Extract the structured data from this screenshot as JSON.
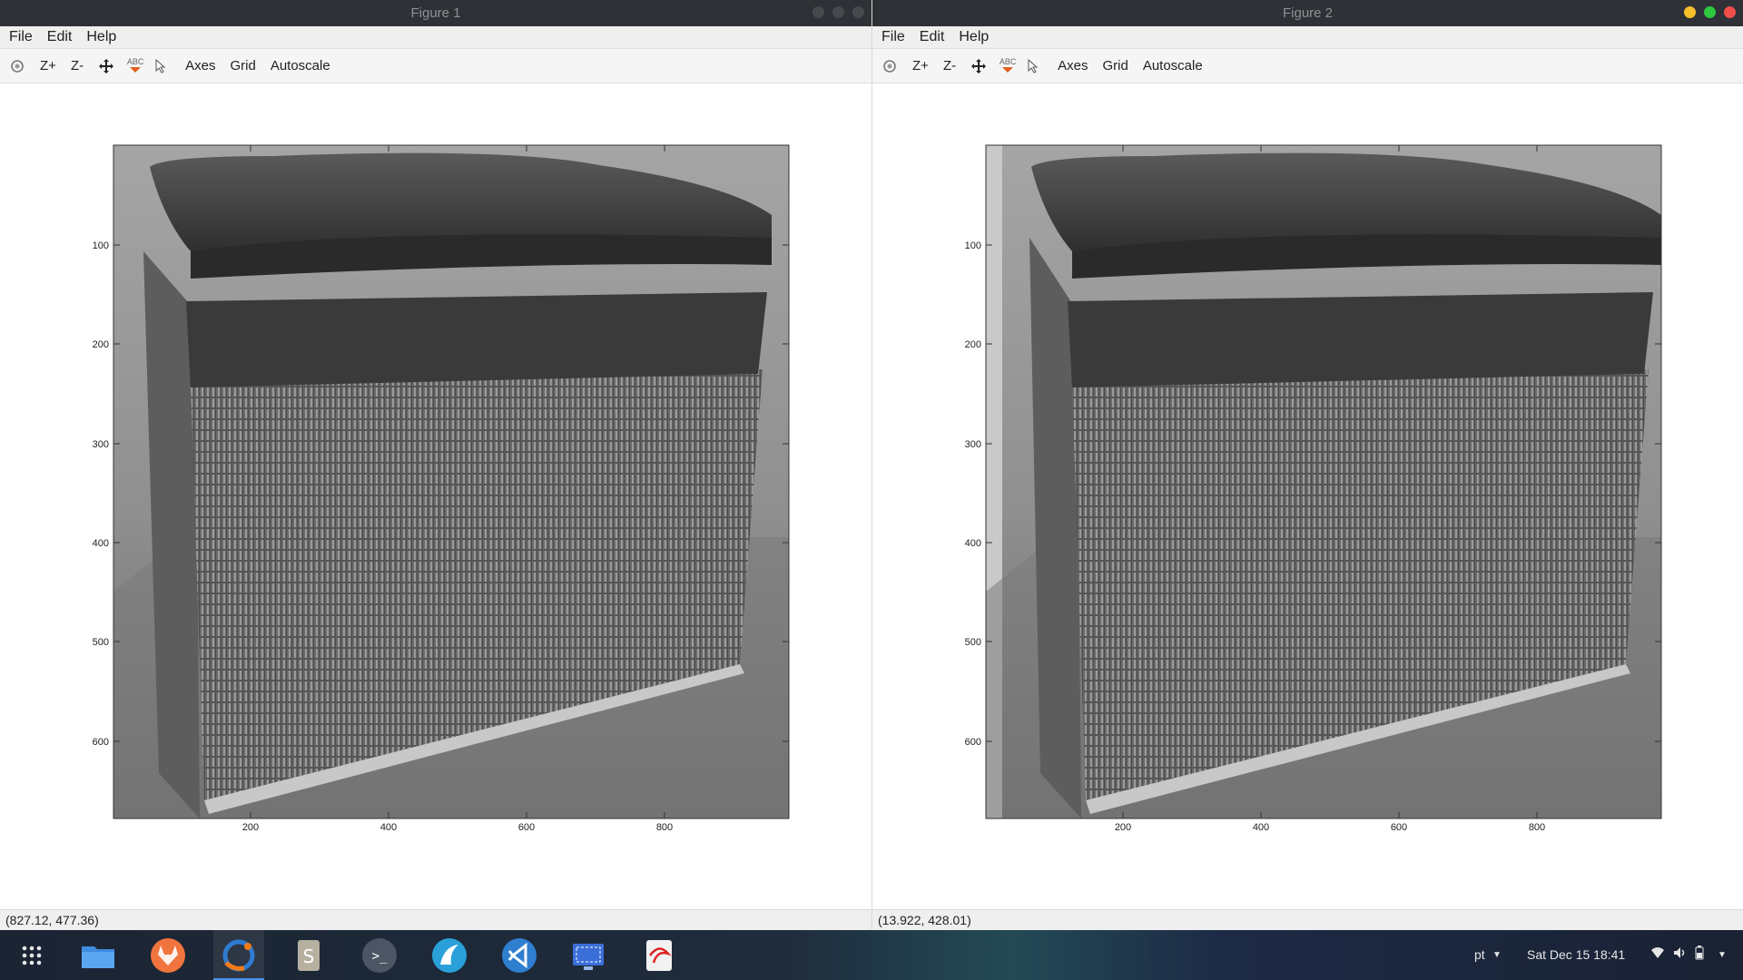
{
  "windows": [
    {
      "title": "Figure 1",
      "menu": [
        "File",
        "Edit",
        "Help"
      ],
      "toolbar": {
        "zoom_in": "Z+",
        "zoom_out": "Z-",
        "text_icon": "ABC",
        "axes": "Axes",
        "grid": "Grid",
        "autoscale": "Autoscale"
      },
      "axes": {
        "y_ticks": [
          "100",
          "200",
          "300",
          "400",
          "500",
          "600"
        ],
        "x_ticks": [
          "200",
          "400",
          "600",
          "800"
        ]
      },
      "status": "(827.12, 477.36)",
      "image_desc": "grayscale-storage-basket"
    },
    {
      "title": "Figure 2",
      "menu": [
        "File",
        "Edit",
        "Help"
      ],
      "toolbar": {
        "zoom_in": "Z+",
        "zoom_out": "Z-",
        "text_icon": "ABC",
        "axes": "Axes",
        "grid": "Grid",
        "autoscale": "Autoscale"
      },
      "axes": {
        "y_ticks": [
          "100",
          "200",
          "300",
          "400",
          "500",
          "600"
        ],
        "x_ticks": [
          "200",
          "400",
          "600",
          "800"
        ]
      },
      "status": "(13.922, 428.01)",
      "image_desc": "grayscale-storage-basket-filtered"
    }
  ],
  "taskbar": {
    "apps": [
      "app-grid-icon",
      "files-icon",
      "gitlab-icon",
      "octave-icon",
      "sublime-icon",
      "terminal-icon",
      "wireshark-icon",
      "vscode-icon",
      "screenshot-icon",
      "document-viewer-icon"
    ],
    "keyboard_layout": "pt",
    "clock": "Sat Dec 15  18:41"
  },
  "colors": {
    "close": "#f14d4a",
    "min": "#f5c02c",
    "max": "#2ec840",
    "accent": "#4a8ee8"
  }
}
